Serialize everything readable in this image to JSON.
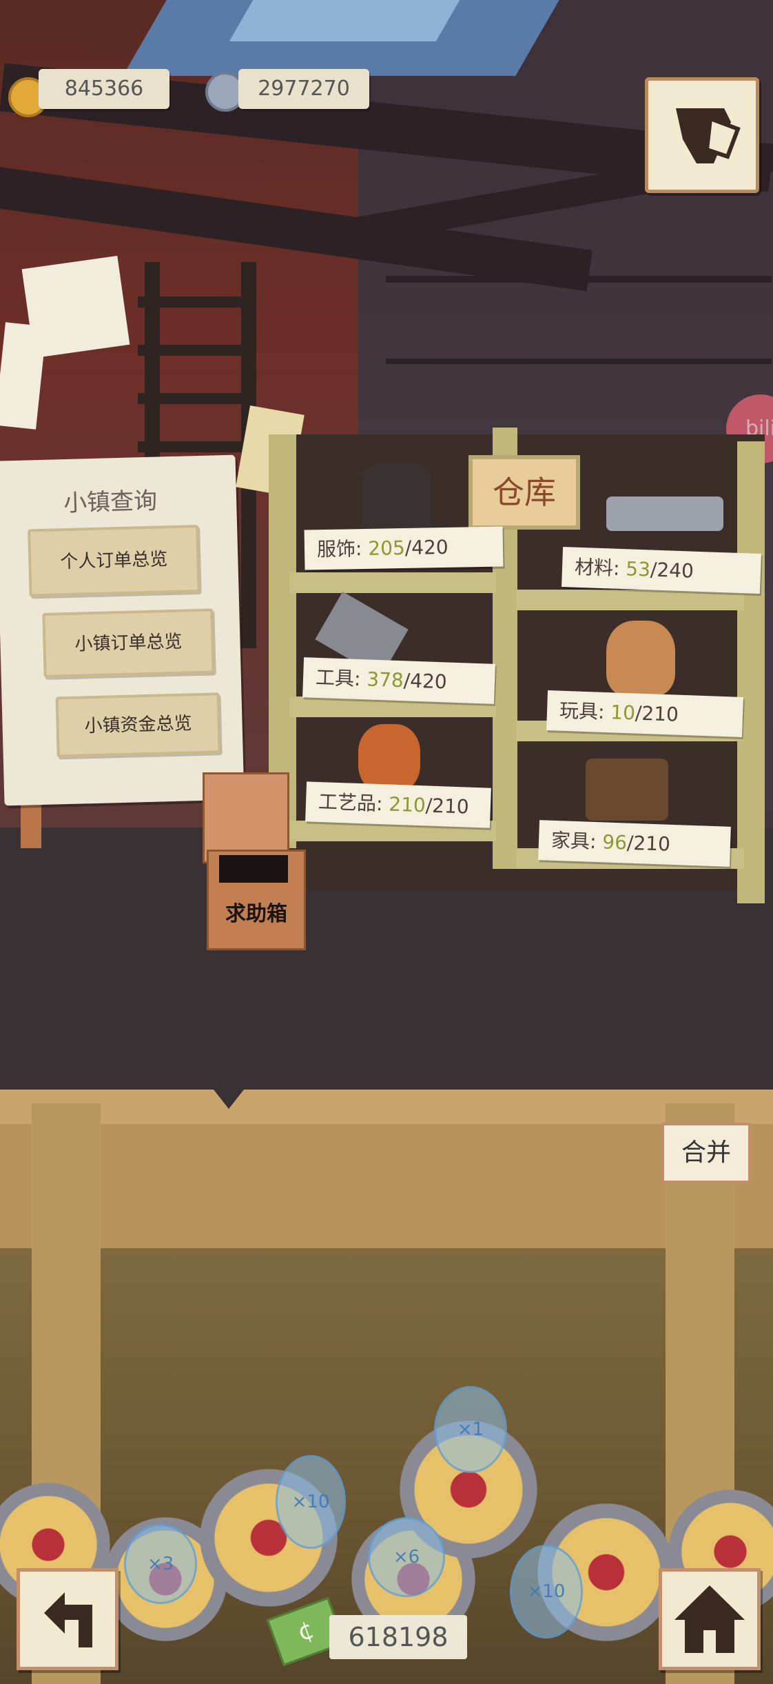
{
  "currency": {
    "medals": "845366",
    "silver": "2977270"
  },
  "board": {
    "title": "小镇查询",
    "buttons": [
      "个人订单总览",
      "小镇订单总览",
      "小镇资金总览"
    ]
  },
  "warehouse": {
    "sign": "仓库",
    "slots": [
      {
        "name": "服饰:",
        "count": "205",
        "cap": "/420"
      },
      {
        "name": "材料:",
        "count": "53",
        "cap": "/240"
      },
      {
        "name": "工具:",
        "count": "378",
        "cap": "/420"
      },
      {
        "name": "玩具:",
        "count": "10",
        "cap": "/210"
      },
      {
        "name": "工艺品:",
        "count": "210",
        "cap": "/210"
      },
      {
        "name": "家具:",
        "count": "96",
        "cap": "/210"
      }
    ]
  },
  "help_box": "求助箱",
  "merge_button": "合并",
  "bubbles": [
    "×1",
    "×10",
    "×3",
    "×6",
    "×10"
  ],
  "bili": "bili",
  "money": "618198",
  "colors": {
    "accent_count": "#8a9a30",
    "frame": "#c58e6a"
  }
}
